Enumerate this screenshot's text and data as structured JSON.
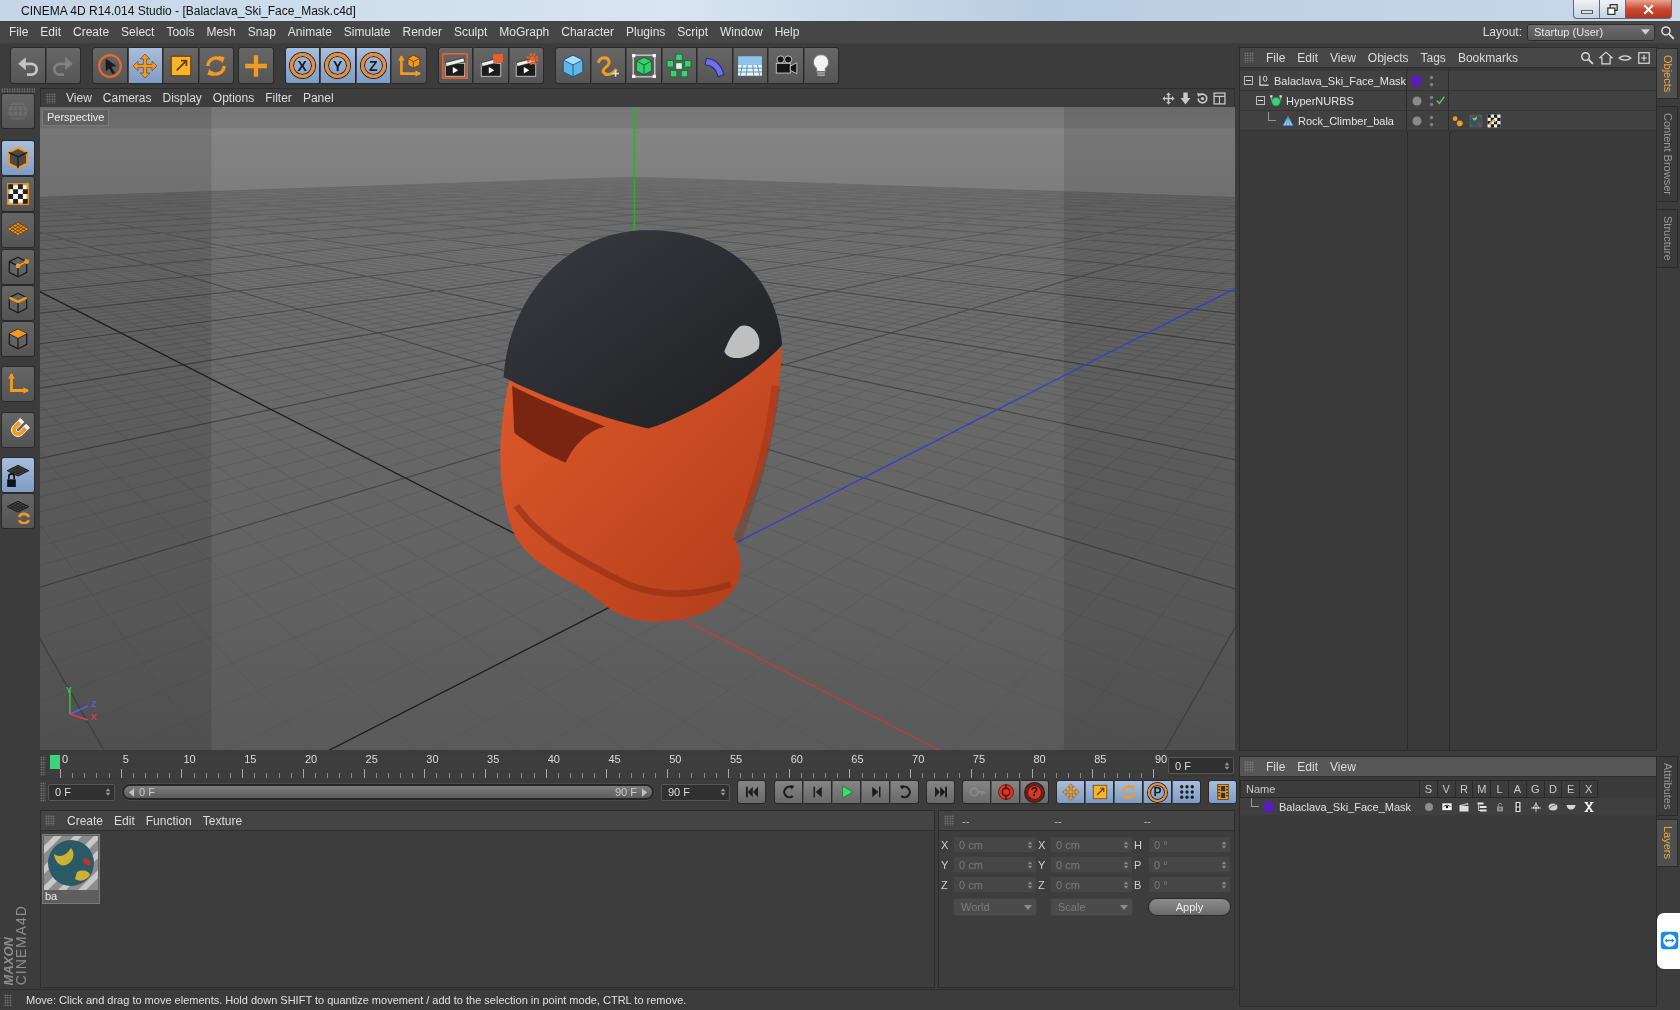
{
  "window": {
    "title": "CINEMA 4D R14.014 Studio - [Balaclava_Ski_Face_Mask.c4d]"
  },
  "menu_bar": {
    "items": [
      "File",
      "Edit",
      "Create",
      "Select",
      "Tools",
      "Mesh",
      "Snap",
      "Animate",
      "Simulate",
      "Render",
      "Sculpt",
      "MoGraph",
      "Character",
      "Plugins",
      "Script",
      "Window",
      "Help"
    ],
    "layout_label": "Layout:",
    "layout_value": "Startup (User)"
  },
  "toolbar": {
    "groups": [
      [
        {
          "kind": "undo",
          "disabled": false
        },
        {
          "kind": "redo",
          "disabled": true
        }
      ],
      [
        {
          "kind": "live-select",
          "selected": false
        },
        {
          "kind": "move",
          "selected": true
        },
        {
          "kind": "scale",
          "selected": false
        },
        {
          "kind": "rotate",
          "selected": false
        }
      ],
      [
        {
          "kind": "recent-tool",
          "selected": false
        }
      ],
      [
        {
          "kind": "axis-lock",
          "label": "X",
          "selected": true
        },
        {
          "kind": "axis-lock",
          "label": "Y",
          "selected": true
        },
        {
          "kind": "axis-lock",
          "label": "Z",
          "selected": true
        },
        {
          "kind": "world-coords",
          "selected": false
        }
      ],
      [
        {
          "kind": "render-view"
        },
        {
          "kind": "render-picture"
        },
        {
          "kind": "render-settings"
        }
      ],
      [
        {
          "kind": "cube"
        },
        {
          "kind": "spline"
        },
        {
          "kind": "nurbs"
        },
        {
          "kind": "cloner"
        },
        {
          "kind": "bend"
        },
        {
          "kind": "floor"
        },
        {
          "kind": "camera"
        },
        {
          "kind": "light"
        }
      ]
    ]
  },
  "mode_toolbar": {
    "groups": [
      [
        {
          "kind": "make-editable",
          "disabled": true
        }
      ],
      [
        {
          "kind": "model",
          "selected": true
        },
        {
          "kind": "texture",
          "selected": false
        },
        {
          "kind": "workplane",
          "selected": false
        }
      ],
      [
        {
          "kind": "points",
          "selected": false
        },
        {
          "kind": "edges",
          "selected": false
        },
        {
          "kind": "polygons",
          "selected": false
        }
      ],
      [
        {
          "kind": "axis-mode",
          "selected": false
        }
      ],
      [
        {
          "kind": "snap",
          "selected": false
        }
      ],
      [
        {
          "kind": "lock-workplane",
          "selected": true
        },
        {
          "kind": "planar-workplane",
          "selected": false
        }
      ]
    ]
  },
  "logo": {
    "brand": "MAXON",
    "product": "CINEMA4D"
  },
  "viewport": {
    "menu": [
      "View",
      "Cameras",
      "Display",
      "Options",
      "Filter",
      "Panel"
    ],
    "camera_label": "Perspective",
    "gizmo": [
      {
        "label": "Y",
        "color": "#3cc83c"
      },
      {
        "label": "Z",
        "color": "#5060e8"
      },
      {
        "label": "X",
        "color": "#e04040"
      }
    ]
  },
  "timeline": {
    "ticks": [
      "0",
      "5",
      "10",
      "15",
      "20",
      "25",
      "30",
      "35",
      "40",
      "45",
      "50",
      "55",
      "60",
      "65",
      "70",
      "75",
      "80",
      "85",
      "90"
    ],
    "playhead": {
      "level": 0
    },
    "current_frame": "0 F"
  },
  "transport": {
    "start_frame": "0 F",
    "range": {
      "start": "0 F",
      "end": "90 F",
      "level": 1
    },
    "end_frame": "90 F",
    "groups": [
      [
        {
          "kind": "go-start"
        }
      ],
      [
        {
          "kind": "prev-key"
        },
        {
          "kind": "prev-frame"
        },
        {
          "kind": "play"
        },
        {
          "kind": "next-frame"
        },
        {
          "kind": "next-key"
        }
      ],
      [
        {
          "kind": "go-end"
        }
      ],
      [
        {
          "kind": "keyframe",
          "disabled": true
        },
        {
          "kind": "record",
          "disabled": false
        },
        {
          "kind": "autokey",
          "label": "?",
          "disabled": false
        }
      ],
      [
        {
          "kind": "move",
          "selected": true
        },
        {
          "kind": "scale",
          "selected": true
        },
        {
          "kind": "rotate",
          "selected": true
        },
        {
          "kind": "param",
          "label": "P",
          "selected": true
        },
        {
          "kind": "point-level",
          "selected": true
        }
      ],
      [
        {
          "kind": "timeline",
          "selected": true
        }
      ]
    ]
  },
  "materials": {
    "menu": [
      "Create",
      "Edit",
      "Function",
      "Texture"
    ],
    "items": [
      {
        "name": "ba"
      }
    ]
  },
  "coordinates": {
    "headers": [
      "--",
      "--",
      "--"
    ],
    "disabled": true,
    "rows": [
      [
        {
          "axis": "X",
          "value": "0 cm"
        },
        {
          "axis": "X",
          "value": "0 cm"
        },
        {
          "axis": "H",
          "value": "0 °"
        }
      ],
      [
        {
          "axis": "Y",
          "value": "0 cm"
        },
        {
          "axis": "Y",
          "value": "0 cm"
        },
        {
          "axis": "P",
          "value": "0 °"
        }
      ],
      [
        {
          "axis": "Z",
          "value": "0 cm"
        },
        {
          "axis": "Z",
          "value": "0 cm"
        },
        {
          "axis": "B",
          "value": "0 °"
        }
      ]
    ],
    "position_mode": "World",
    "size_mode": "Scale",
    "apply": "Apply"
  },
  "status_bar": {
    "text": "Move: Click and drag to move elements. Hold down SHIFT to quantize movement / add to the selection in point mode, CTRL to remove."
  },
  "objects": {
    "menu": [
      "File",
      "Edit",
      "View",
      "Objects",
      "Tags",
      "Bookmarks"
    ],
    "tree": [
      {
        "kind": "null",
        "name": "Balaclava_Ski_Face_Mask",
        "color": "#5a1cb4",
        "expanded": true,
        "children": [
          {
            "kind": "nurbs",
            "name": "HyperNURBS",
            "expanded": true,
            "enabled": true,
            "children": [
              {
                "kind": "polygon",
                "name": "Rock_Climber_bala",
                "tags": [
                  {
                    "kind": "phong"
                  },
                  {
                    "kind": "material"
                  },
                  {
                    "kind": "uvw"
                  }
                ]
              }
            ]
          }
        ]
      }
    ]
  },
  "layers": {
    "menu": [
      "File",
      "Edit",
      "View"
    ],
    "columns": [
      "Name",
      "S",
      "V",
      "R",
      "M",
      "L",
      "A",
      "G",
      "D",
      "E",
      "X"
    ],
    "rows": [
      {
        "name": "Balaclava_Ski_Face_Mask",
        "color": "#5a1cb4",
        "switches": [
          {
            "kind": "solo",
            "on": false
          },
          {
            "kind": "view",
            "on": true
          },
          {
            "kind": "render",
            "on": true
          },
          {
            "kind": "manager",
            "on": true
          },
          {
            "kind": "locked",
            "on": false
          },
          {
            "kind": "animation",
            "on": true
          },
          {
            "kind": "generators",
            "on": true
          },
          {
            "kind": "deformers",
            "on": true
          },
          {
            "kind": "expressions",
            "on": true
          },
          {
            "kind": "xref",
            "on": true
          }
        ]
      }
    ]
  },
  "side_tabs": {
    "top": [
      {
        "label": "Objects",
        "selected": true
      },
      {
        "label": "Content Browser",
        "selected": false
      },
      {
        "label": "Structure",
        "selected": false
      }
    ],
    "bottom": [
      {
        "label": "Attributes",
        "selected": false
      },
      {
        "label": "Layers",
        "selected": true
      }
    ]
  }
}
